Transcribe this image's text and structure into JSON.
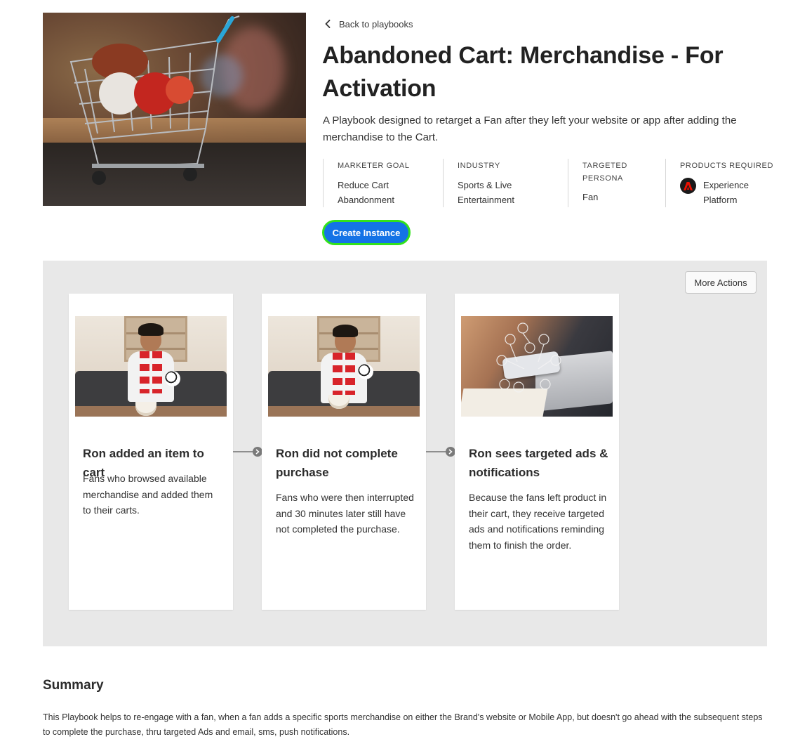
{
  "header": {
    "back_label": "Back to playbooks",
    "title": "Abandoned Cart: Merchandise - For Activation",
    "description": "A Playbook designed to retarget a Fan after they left your website or app after adding the merchandise to the Cart."
  },
  "meta": {
    "marketer_goal": {
      "label": "MARKETER GOAL",
      "value": "Reduce Cart Abandonment"
    },
    "industry": {
      "label": "INDUSTRY",
      "value": "Sports & Live Entertainment"
    },
    "persona": {
      "label": "TARGETED PERSONA",
      "value": "Fan"
    },
    "products": {
      "label": "PRODUCTS REQUIRED",
      "value": "Experience Platform",
      "icon": "adobe-logo-icon"
    }
  },
  "actions": {
    "create_instance": "Create Instance",
    "more_actions": "More Actions"
  },
  "journey": {
    "steps": [
      {
        "title": "Ron added an item to cart",
        "description": "Fans who browsed available merchandise and added them to their carts."
      },
      {
        "title": "Ron did not complete purchase",
        "description": "Fans who were then interrupted and 30 minutes later still have not completed the purchase."
      },
      {
        "title": "Ron sees targeted ads & notifications",
        "description": "Because the fans left product in their cart, they receive targeted ads and notifications reminding them to finish the order."
      }
    ]
  },
  "summary": {
    "title": "Summary",
    "text": "This Playbook helps to re-engage with a fan, when a fan adds a specific sports merchandise on either the Brand's website or Mobile App, but doesn't go ahead with the subsequent steps to complete the purchase, thru targeted Ads and email, sms, push notifications."
  },
  "colors": {
    "primary_button": "#1473e6",
    "focus_ring": "#32e21b",
    "panel_bg": "#e8e8e8"
  }
}
